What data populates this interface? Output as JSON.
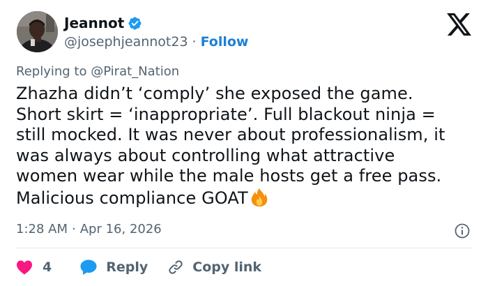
{
  "author": {
    "display_name": "Jeannot",
    "handle": "@josephjeannot23",
    "separator": "·",
    "follow_label": "Follow",
    "verified": true,
    "verified_color": "#1d9bf0"
  },
  "reply_context": {
    "prefix": "Replying to",
    "mention": "@Pirat_Nation"
  },
  "tweet": {
    "lines": [
      "Zhazha didn’t ‘comply’ she exposed the game.",
      "Short skirt = ‘inappropriate’. Full blackout ninja =",
      "still mocked. It was never about professionalism, it",
      "was always about controlling what attractive",
      "women wear while the male hosts get a free pass.",
      "Malicious compliance GOAT"
    ],
    "trailing_emoji": "fire-emoji"
  },
  "meta": {
    "time": "1:28 AM",
    "separator": "·",
    "date": "Apr 16, 2026"
  },
  "actions": {
    "like_count": "4",
    "reply_label": "Reply",
    "copy_link_label": "Copy link"
  },
  "colors": {
    "text": "#0f1419",
    "muted": "#536471",
    "link": "#1d80d4",
    "like": "#f91880",
    "reply": "#1d9bf0",
    "divider": "#e1e8ed"
  },
  "icons": [
    "avatar-photo",
    "verified-badge-icon",
    "x-logo-icon",
    "info-icon",
    "heart-icon",
    "speech-bubble-icon",
    "link-icon"
  ]
}
